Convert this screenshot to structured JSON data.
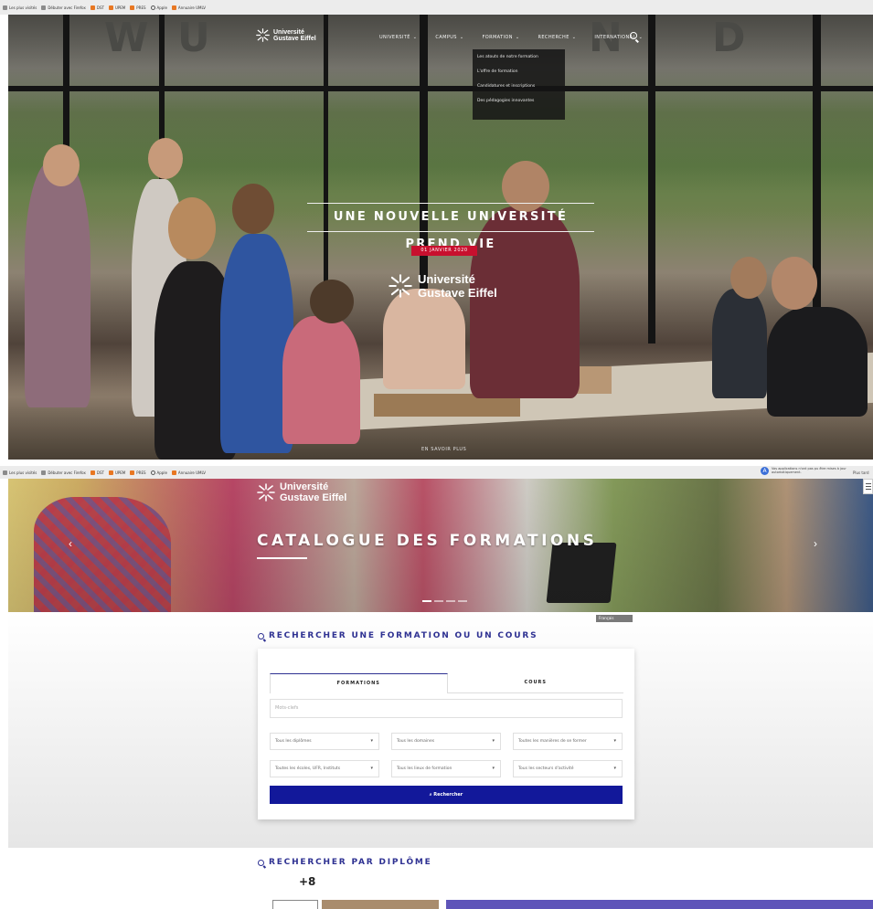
{
  "shot1": {
    "bookmarks": [
      "Les plus visités",
      "Débuter avec Firefox",
      "DST",
      "UPEM",
      "PRES",
      "Apple",
      "Annuaire UMLV"
    ],
    "wall_letters": [
      "W",
      "U",
      "N",
      "D"
    ],
    "logo_line1": "Université",
    "logo_line2": "Gustave Eiffel",
    "nav_items": [
      "UNIVERSITÉ",
      "CAMPUS",
      "FORMATION",
      "RECHERCHE",
      "INTERNATIONAL"
    ],
    "nav_chevron": "⌄",
    "dropdown": [
      "Les atouts de notre formation",
      "L'offre de formation",
      "Candidatures et inscriptions",
      "Des pédagogies innovantes"
    ],
    "title": "UNE NOUVELLE UNIVERSITÉ PREND VIE",
    "date": "01 JANVIER 2020",
    "big_logo_line1": "Université",
    "big_logo_line2": "Gustave Eiffel",
    "en_savoir": "EN SAVOIR PLUS"
  },
  "shot2": {
    "bookmarks": [
      "Les plus visités",
      "Débuter avec Firefox",
      "DST",
      "UPEM",
      "PRES",
      "Apple",
      "Annuaire UMLV"
    ],
    "notification": "Vos applications n'ont pas pu être mises à jour automatiquement.",
    "notification_more": "Plus tard",
    "logo_line1": "Université",
    "logo_line2": "Gustave Eiffel",
    "catalogue_title": "CATALOGUE DES FORMATIONS",
    "arrow_left": "‹",
    "arrow_right": "›",
    "lang_button": "Français",
    "search_title": "RECHERCHER UNE FORMATION OU UN COURS",
    "tabs": [
      "FORMATIONS",
      "COURS"
    ],
    "keyword_placeholder": "Mots-clefs",
    "selects_row1": [
      "Tous les diplômes",
      "Tous les domaines",
      "Toutes les manières de se former"
    ],
    "selects_row2": [
      "Toutes les écoles, UFR, Instituts",
      "Tous les lieux de formation",
      "Tous les secteurs d'activité"
    ],
    "caret": "▾",
    "search_button": "Rechercher",
    "diplome_title": "RECHERCHER PAR DIPLÔME",
    "plus_count": "+8"
  },
  "colors": {
    "primary_blue": "#2e3192",
    "button_blue": "#12189a",
    "date_red": "#c8102e",
    "purple_block": "#5e54b9"
  }
}
